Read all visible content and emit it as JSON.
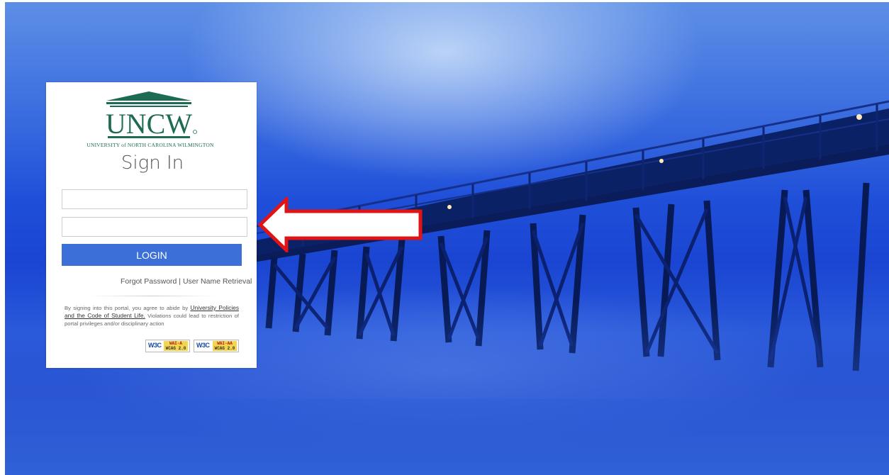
{
  "logo": {
    "wordmark": "UNCW",
    "university_name": "UNIVERSITY of NORTH CAROLINA WILMINGTON"
  },
  "signin": {
    "title": "Sign In",
    "username_value": "",
    "password_value": ""
  },
  "login_button": "LOGIN",
  "links": {
    "forgot_password": "Forgot Password",
    "separator": " | ",
    "username_retrieval": "User Name Retrieval"
  },
  "policy": {
    "prefix": "By signing into this portal, you agree to abide by ",
    "link_text": "University Policies and the Code of Student Life.",
    "suffix": " Violations could lead to restriction of portal privileges and/or disciplinary action"
  },
  "badges": [
    {
      "w3c": "W3C",
      "line1": "WAI-A",
      "line2": "WCAG 2.0"
    },
    {
      "w3c": "W3C",
      "line1": "WAI-AA",
      "line2": "WCAG 2.0"
    }
  ],
  "colors": {
    "uncw_green": "#1d6b54",
    "login_blue": "#3c70d8",
    "arrow_red": "#e01414"
  },
  "icons": {
    "arrow": "left-arrow-icon",
    "logo": "uncw-logo-icon"
  }
}
